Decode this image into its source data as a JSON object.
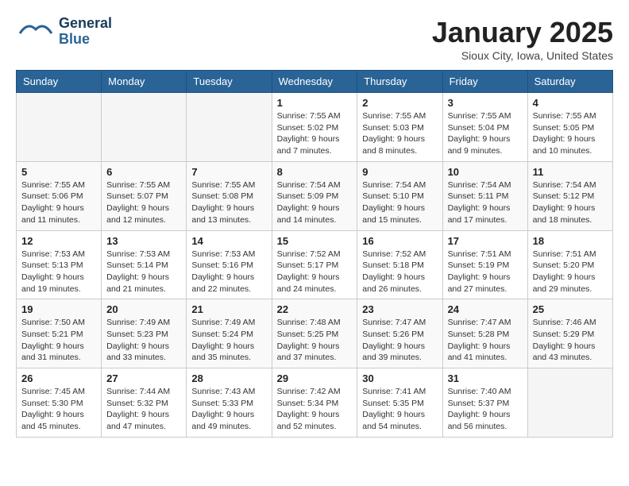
{
  "header": {
    "logo_line1": "General",
    "logo_line2": "Blue",
    "title": "January 2025",
    "subtitle": "Sioux City, Iowa, United States"
  },
  "weekdays": [
    "Sunday",
    "Monday",
    "Tuesday",
    "Wednesday",
    "Thursday",
    "Friday",
    "Saturday"
  ],
  "weeks": [
    [
      {
        "day": "",
        "info": ""
      },
      {
        "day": "",
        "info": ""
      },
      {
        "day": "",
        "info": ""
      },
      {
        "day": "1",
        "info": "Sunrise: 7:55 AM\nSunset: 5:02 PM\nDaylight: 9 hours and 7 minutes."
      },
      {
        "day": "2",
        "info": "Sunrise: 7:55 AM\nSunset: 5:03 PM\nDaylight: 9 hours and 8 minutes."
      },
      {
        "day": "3",
        "info": "Sunrise: 7:55 AM\nSunset: 5:04 PM\nDaylight: 9 hours and 9 minutes."
      },
      {
        "day": "4",
        "info": "Sunrise: 7:55 AM\nSunset: 5:05 PM\nDaylight: 9 hours and 10 minutes."
      }
    ],
    [
      {
        "day": "5",
        "info": "Sunrise: 7:55 AM\nSunset: 5:06 PM\nDaylight: 9 hours and 11 minutes."
      },
      {
        "day": "6",
        "info": "Sunrise: 7:55 AM\nSunset: 5:07 PM\nDaylight: 9 hours and 12 minutes."
      },
      {
        "day": "7",
        "info": "Sunrise: 7:55 AM\nSunset: 5:08 PM\nDaylight: 9 hours and 13 minutes."
      },
      {
        "day": "8",
        "info": "Sunrise: 7:54 AM\nSunset: 5:09 PM\nDaylight: 9 hours and 14 minutes."
      },
      {
        "day": "9",
        "info": "Sunrise: 7:54 AM\nSunset: 5:10 PM\nDaylight: 9 hours and 15 minutes."
      },
      {
        "day": "10",
        "info": "Sunrise: 7:54 AM\nSunset: 5:11 PM\nDaylight: 9 hours and 17 minutes."
      },
      {
        "day": "11",
        "info": "Sunrise: 7:54 AM\nSunset: 5:12 PM\nDaylight: 9 hours and 18 minutes."
      }
    ],
    [
      {
        "day": "12",
        "info": "Sunrise: 7:53 AM\nSunset: 5:13 PM\nDaylight: 9 hours and 19 minutes."
      },
      {
        "day": "13",
        "info": "Sunrise: 7:53 AM\nSunset: 5:14 PM\nDaylight: 9 hours and 21 minutes."
      },
      {
        "day": "14",
        "info": "Sunrise: 7:53 AM\nSunset: 5:16 PM\nDaylight: 9 hours and 22 minutes."
      },
      {
        "day": "15",
        "info": "Sunrise: 7:52 AM\nSunset: 5:17 PM\nDaylight: 9 hours and 24 minutes."
      },
      {
        "day": "16",
        "info": "Sunrise: 7:52 AM\nSunset: 5:18 PM\nDaylight: 9 hours and 26 minutes."
      },
      {
        "day": "17",
        "info": "Sunrise: 7:51 AM\nSunset: 5:19 PM\nDaylight: 9 hours and 27 minutes."
      },
      {
        "day": "18",
        "info": "Sunrise: 7:51 AM\nSunset: 5:20 PM\nDaylight: 9 hours and 29 minutes."
      }
    ],
    [
      {
        "day": "19",
        "info": "Sunrise: 7:50 AM\nSunset: 5:21 PM\nDaylight: 9 hours and 31 minutes."
      },
      {
        "day": "20",
        "info": "Sunrise: 7:49 AM\nSunset: 5:23 PM\nDaylight: 9 hours and 33 minutes."
      },
      {
        "day": "21",
        "info": "Sunrise: 7:49 AM\nSunset: 5:24 PM\nDaylight: 9 hours and 35 minutes."
      },
      {
        "day": "22",
        "info": "Sunrise: 7:48 AM\nSunset: 5:25 PM\nDaylight: 9 hours and 37 minutes."
      },
      {
        "day": "23",
        "info": "Sunrise: 7:47 AM\nSunset: 5:26 PM\nDaylight: 9 hours and 39 minutes."
      },
      {
        "day": "24",
        "info": "Sunrise: 7:47 AM\nSunset: 5:28 PM\nDaylight: 9 hours and 41 minutes."
      },
      {
        "day": "25",
        "info": "Sunrise: 7:46 AM\nSunset: 5:29 PM\nDaylight: 9 hours and 43 minutes."
      }
    ],
    [
      {
        "day": "26",
        "info": "Sunrise: 7:45 AM\nSunset: 5:30 PM\nDaylight: 9 hours and 45 minutes."
      },
      {
        "day": "27",
        "info": "Sunrise: 7:44 AM\nSunset: 5:32 PM\nDaylight: 9 hours and 47 minutes."
      },
      {
        "day": "28",
        "info": "Sunrise: 7:43 AM\nSunset: 5:33 PM\nDaylight: 9 hours and 49 minutes."
      },
      {
        "day": "29",
        "info": "Sunrise: 7:42 AM\nSunset: 5:34 PM\nDaylight: 9 hours and 52 minutes."
      },
      {
        "day": "30",
        "info": "Sunrise: 7:41 AM\nSunset: 5:35 PM\nDaylight: 9 hours and 54 minutes."
      },
      {
        "day": "31",
        "info": "Sunrise: 7:40 AM\nSunset: 5:37 PM\nDaylight: 9 hours and 56 minutes."
      },
      {
        "day": "",
        "info": ""
      }
    ]
  ]
}
